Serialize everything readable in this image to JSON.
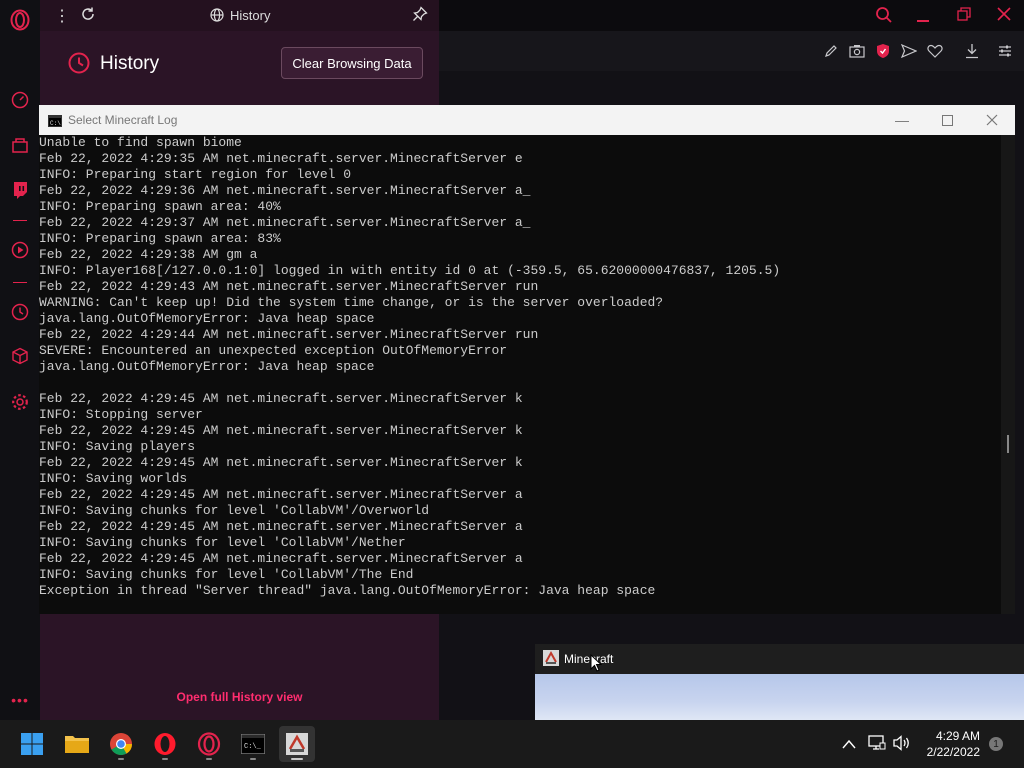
{
  "history_panel": {
    "topbar_title": "History",
    "heading": "History",
    "clear_button": "Clear Browsing Data",
    "open_full": "Open full History view"
  },
  "console": {
    "title": "Select Minecraft Log",
    "lines": [
      "Unable to find spawn biome",
      "Feb 22, 2022 4:29:35 AM net.minecraft.server.MinecraftServer e",
      "INFO: Preparing start region for level 0",
      "Feb 22, 2022 4:29:36 AM net.minecraft.server.MinecraftServer a_",
      "INFO: Preparing spawn area: 40%",
      "Feb 22, 2022 4:29:37 AM net.minecraft.server.MinecraftServer a_",
      "INFO: Preparing spawn area: 83%",
      "Feb 22, 2022 4:29:38 AM gm a",
      "INFO: Player168[/127.0.0.1:0] logged in with entity id 0 at (-359.5, 65.62000000476837, 1205.5)",
      "Feb 22, 2022 4:29:43 AM net.minecraft.server.MinecraftServer run",
      "WARNING: Can't keep up! Did the system time change, or is the server overloaded?",
      "java.lang.OutOfMemoryError: Java heap space",
      "Feb 22, 2022 4:29:44 AM net.minecraft.server.MinecraftServer run",
      "SEVERE: Encountered an unexpected exception OutOfMemoryError",
      "java.lang.OutOfMemoryError: Java heap space",
      "",
      "Feb 22, 2022 4:29:45 AM net.minecraft.server.MinecraftServer k",
      "INFO: Stopping server",
      "Feb 22, 2022 4:29:45 AM net.minecraft.server.MinecraftServer k",
      "INFO: Saving players",
      "Feb 22, 2022 4:29:45 AM net.minecraft.server.MinecraftServer k",
      "INFO: Saving worlds",
      "Feb 22, 2022 4:29:45 AM net.minecraft.server.MinecraftServer a",
      "INFO: Saving chunks for level 'CollabVM'/Overworld",
      "Feb 22, 2022 4:29:45 AM net.minecraft.server.MinecraftServer a",
      "INFO: Saving chunks for level 'CollabVM'/Nether",
      "Feb 22, 2022 4:29:45 AM net.minecraft.server.MinecraftServer a",
      "INFO: Saving chunks for level 'CollabVM'/The End",
      "Exception in thread \"Server thread\" java.lang.OutOfMemoryError: Java heap space"
    ]
  },
  "minecraft_window": {
    "title": "Minecraft"
  },
  "taskbar": {
    "apps": [
      "start-icon",
      "file-explorer-icon",
      "chrome-icon",
      "opera-icon",
      "opera-gx-icon",
      "terminal-icon",
      "java-icon"
    ],
    "time": "4:29 AM",
    "date": "2/22/2022",
    "notification_count": "1"
  },
  "colors": {
    "accent": "#e3234d",
    "console_bg": "#0c0c0c",
    "console_text": "#cccccc"
  }
}
